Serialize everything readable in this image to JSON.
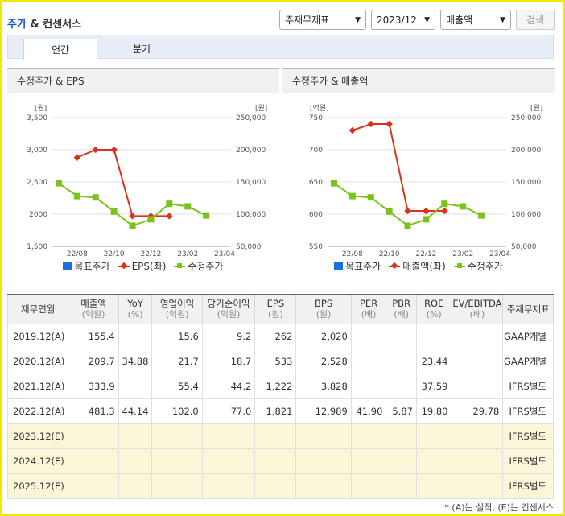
{
  "header": {
    "title_main": "주가",
    "title_rest": " & 컨센서스",
    "selects": [
      "주재무제표",
      "2023/12",
      "매출액"
    ],
    "search_label": "검색"
  },
  "tabs": [
    {
      "label": "연간",
      "active": true
    },
    {
      "label": "분기",
      "active": false
    }
  ],
  "panels": [
    {
      "heading": "수정주가 & EPS",
      "left_unit": "[원]",
      "right_unit": "[원]",
      "legend": [
        "목표주가",
        "EPS(좌)",
        "수정주가"
      ]
    },
    {
      "heading": "수정주가 & 매출액",
      "left_unit": "[억원]",
      "right_unit": "[원]",
      "legend": [
        "목표주가",
        "매출액(좌)",
        "수정주가"
      ]
    }
  ],
  "chart_data": [
    {
      "type": "line",
      "x": [
        "22/07",
        "22/08",
        "22/09",
        "22/10",
        "22/11",
        "22/12",
        "23/01",
        "23/02",
        "23/03",
        "23/04"
      ],
      "x_tick_labels": [
        "22/08",
        "22/10",
        "22/12",
        "23/02",
        "23/04"
      ],
      "left_axis": {
        "min": 1500,
        "max": 3500,
        "ticks": [
          "1,500",
          "2000",
          "2,500",
          "3,000",
          "3,500"
        ]
      },
      "right_axis": {
        "min": 50000,
        "max": 250000,
        "ticks": [
          "50,000",
          "100,000",
          "150,000",
          "200,000",
          "250,000"
        ]
      },
      "series": [
        {
          "name": "EPS(좌)",
          "axis": "left",
          "color": "#d9331d",
          "values": [
            null,
            2880,
            3000,
            3000,
            1970,
            1970,
            1970,
            null,
            null,
            null
          ]
        },
        {
          "name": "수정주가",
          "axis": "right",
          "color": "#7cc21e",
          "values": [
            148000,
            128000,
            126000,
            104000,
            82000,
            92000,
            116000,
            112000,
            98000,
            null
          ]
        }
      ]
    },
    {
      "type": "line",
      "x": [
        "22/07",
        "22/08",
        "22/09",
        "22/10",
        "22/11",
        "22/12",
        "23/01",
        "23/02",
        "23/03",
        "23/04"
      ],
      "x_tick_labels": [
        "22/08",
        "22/10",
        "22/12",
        "23/02",
        "23/04"
      ],
      "left_axis": {
        "min": 550,
        "max": 750,
        "ticks": [
          "550",
          "600",
          "650",
          "700",
          "750"
        ]
      },
      "right_axis": {
        "min": 50000,
        "max": 250000,
        "ticks": [
          "50,000",
          "100,000",
          "150,000",
          "200,000",
          "250,000"
        ]
      },
      "series": [
        {
          "name": "매출액(좌)",
          "axis": "left",
          "color": "#d9331d",
          "values": [
            null,
            730,
            740,
            740,
            605,
            605,
            605,
            null,
            null,
            null
          ]
        },
        {
          "name": "수정주가",
          "axis": "right",
          "color": "#7cc21e",
          "values": [
            148000,
            128000,
            126000,
            104000,
            82000,
            92000,
            116000,
            112000,
            98000,
            null
          ]
        }
      ]
    }
  ],
  "table": {
    "columns": [
      {
        "label": "재무연월",
        "sub": ""
      },
      {
        "label": "매출액",
        "sub": "(억원)"
      },
      {
        "label": "YoY",
        "sub": "(%)"
      },
      {
        "label": "영업이익",
        "sub": "(억원)"
      },
      {
        "label": "당기순이익",
        "sub": "(억원)"
      },
      {
        "label": "EPS",
        "sub": "(원)"
      },
      {
        "label": "BPS",
        "sub": "(원)"
      },
      {
        "label": "PER",
        "sub": "(배)"
      },
      {
        "label": "PBR",
        "sub": "(배)"
      },
      {
        "label": "ROE",
        "sub": "(%)"
      },
      {
        "label": "EV/EBITDA",
        "sub": "(배)"
      },
      {
        "label": "주재무제표",
        "sub": ""
      }
    ],
    "rows": [
      {
        "est": false,
        "cells": [
          "2019.12(A)",
          "155.4",
          "",
          "15.6",
          "9.2",
          "262",
          "2,020",
          "",
          "",
          "",
          "",
          "GAAP개별"
        ]
      },
      {
        "est": false,
        "cells": [
          "2020.12(A)",
          "209.7",
          "34.88",
          "21.7",
          "18.7",
          "533",
          "2,528",
          "",
          "",
          "23.44",
          "",
          "GAAP개별"
        ]
      },
      {
        "est": false,
        "cells": [
          "2021.12(A)",
          "333.9",
          "",
          "55.4",
          "44.2",
          "1,222",
          "3,828",
          "",
          "",
          "37.59",
          "",
          "IFRS별도"
        ]
      },
      {
        "est": false,
        "cells": [
          "2022.12(A)",
          "481.3",
          "44.14",
          "102.0",
          "77.0",
          "1,821",
          "12,989",
          "41.90",
          "5.87",
          "19.80",
          "29.78",
          "IFRS별도"
        ]
      },
      {
        "est": true,
        "cells": [
          "2023.12(E)",
          "",
          "",
          "",
          "",
          "",
          "",
          "",
          "",
          "",
          "",
          "IFRS별도"
        ]
      },
      {
        "est": true,
        "cells": [
          "2024.12(E)",
          "",
          "",
          "",
          "",
          "",
          "",
          "",
          "",
          "",
          "",
          "IFRS별도"
        ]
      },
      {
        "est": true,
        "cells": [
          "2025.12(E)",
          "",
          "",
          "",
          "",
          "",
          "",
          "",
          "",
          "",
          "",
          "IFRS별도"
        ]
      }
    ]
  },
  "footnote": "* (A)는 실적, (E)는 컨센서스"
}
